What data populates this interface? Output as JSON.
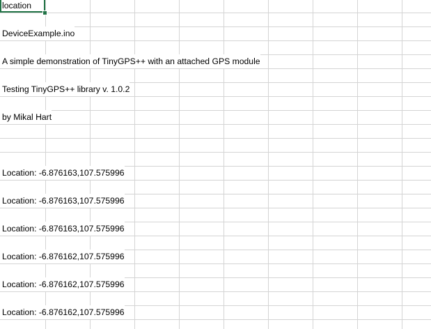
{
  "sheet": {
    "selected_cell_text": "location",
    "rows": [
      "location",
      "",
      "DeviceExample.ino",
      "",
      "A simple demonstration of TinyGPS++ with an attached GPS module",
      "",
      "Testing TinyGPS++ library v. 1.0.2",
      "",
      "by Mikal Hart",
      "",
      "",
      "",
      "Location: -6.876163,107.575996",
      "",
      "Location: -6.876163,107.575996",
      "",
      "Location: -6.876163,107.575996",
      "",
      "Location: -6.876162,107.575996",
      "",
      "Location: -6.876162,107.575996",
      "",
      "Location: -6.876162,107.575996",
      ""
    ]
  },
  "colors": {
    "gridline": "#d4d4d4",
    "selection": "#217346",
    "text": "#000000"
  }
}
